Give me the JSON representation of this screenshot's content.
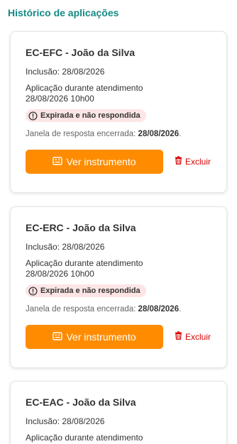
{
  "header": {
    "title": "Histórico de aplicações"
  },
  "cards": [
    {
      "title": "EC-EFC - João da Silva",
      "inclusion": "Inclusão: 28/08/2026",
      "application_type": "Aplicação durante atendimento",
      "application_datetime": "28/08/2026 10h00",
      "status": "Expirada e não respondida",
      "deadline_prefix": "Janela de resposta encerrada: ",
      "deadline_date": "28/08/2026",
      "deadline_suffix": ".",
      "view_label": "Ver instrumento",
      "delete_label": "Excluir"
    },
    {
      "title": "EC-ERC - João da Silva",
      "inclusion": "Inclusão: 28/08/2026",
      "application_type": "Aplicação durante atendimento",
      "application_datetime": "28/08/2026 10h00",
      "status": "Expirada e não respondida",
      "deadline_prefix": "Janela de resposta encerrada: ",
      "deadline_date": "28/08/2026",
      "deadline_suffix": ".",
      "view_label": "Ver instrumento",
      "delete_label": "Excluir"
    },
    {
      "title": "EC-EAC - João da Silva",
      "inclusion": "Inclusão: 28/08/2026",
      "application_type": "Aplicação durante atendimento"
    }
  ],
  "colors": {
    "title_teal": "#138a84",
    "primary_orange": "#ff8c00",
    "danger_red": "#d90000",
    "badge_bg": "#fde5e5"
  },
  "icons": {
    "status": "clock-alert-icon",
    "view": "form-icon",
    "delete": "trash-icon"
  }
}
